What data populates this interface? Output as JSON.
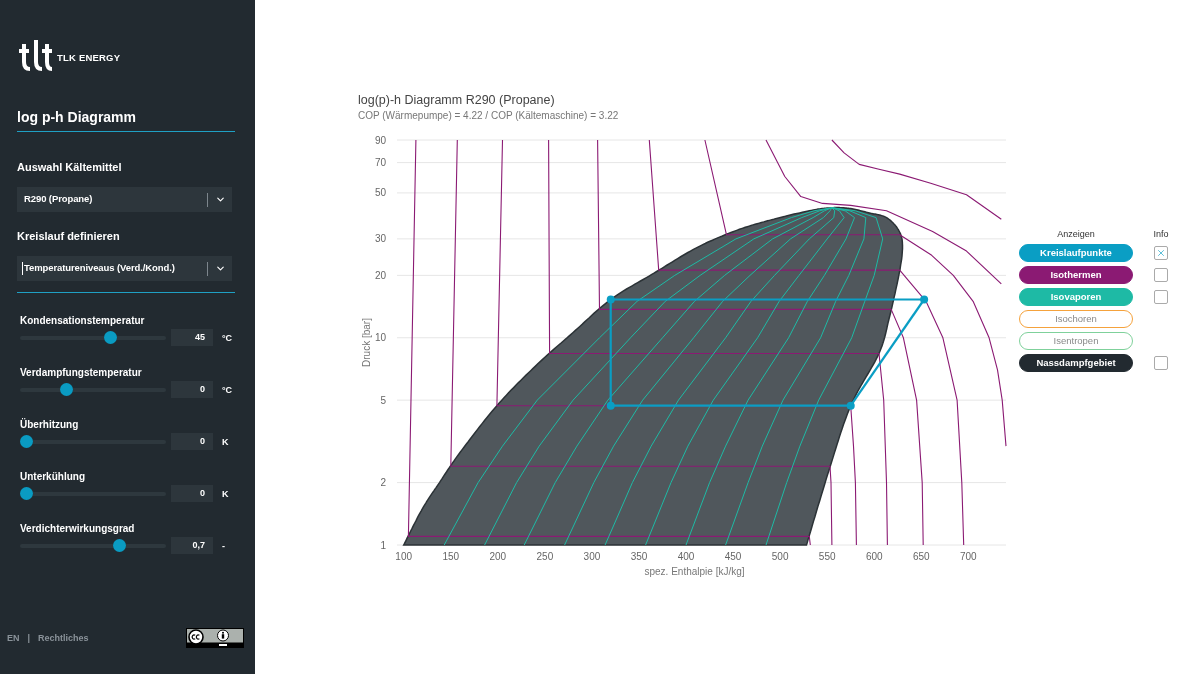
{
  "sidebar": {
    "brand": "TLK ENERGY",
    "heading": "log p-h Diagramm",
    "selects": [
      {
        "label": "Auswahl Kältemittel",
        "value": "R290 (Propane)",
        "focused": false
      },
      {
        "label": "Kreislauf definieren",
        "value": "Temperatureniveaus (Verd./Kond.)",
        "focused": true
      }
    ],
    "sliders": [
      {
        "label": "Kondensationstemperatur",
        "level": 0.63,
        "value": "45",
        "unit": "°C"
      },
      {
        "label": "Verdampfungstemperatur",
        "level": 0.3,
        "value": "0",
        "unit": "°C"
      },
      {
        "label": "Überhitzung",
        "level": 0,
        "value": "0",
        "unit": "K"
      },
      {
        "label": "Unterkühlung",
        "level": 0,
        "value": "0",
        "unit": "K"
      },
      {
        "label": "Verdichterwirkungsgrad",
        "level": 0.7,
        "value": "0,7",
        "unit": "-"
      }
    ],
    "footer": {
      "language": "EN",
      "separator": "|",
      "legal": "Rechtliches"
    }
  },
  "chart": {
    "subtitle": "COP (Wärmepumpe) = 4.22 / COP (Kältemaschine) = 3.22",
    "chart_data": {
      "type": "line",
      "title": "log(p)-h Diagramm R290 (Propane)",
      "xlabel": "spez. Enthalpie [kJ/kg]",
      "ylabel": "Druck [bar]",
      "xlim": [
        95,
        740
      ],
      "ylim": [
        1,
        90
      ],
      "log": true,
      "grid": true,
      "xticks": [
        100,
        150,
        200,
        250,
        300,
        350,
        400,
        450,
        500,
        550,
        600,
        650,
        700
      ],
      "yticks": [
        1,
        2,
        5,
        10,
        20,
        30,
        50,
        70,
        90
      ],
      "series": [
        {
          "type": "area",
          "color": "#50575c",
          "x": [
            100,
            120,
            138,
            160,
            199,
            240,
            280,
            320,
            366,
            410,
            450,
            485,
            531,
            555,
            575,
            595,
            613,
            626,
            630,
            627,
            616,
            605,
            575,
            552,
            528
          ],
          "values": [
            1,
            1.5,
            2,
            2.8,
            4.7,
            7.3,
            10.6,
            15.3,
            20.5,
            27,
            32.5,
            36.5,
            41,
            42.4,
            42,
            40,
            38,
            33,
            28,
            21,
            12.5,
            8.4,
            4.7,
            2.3,
            1
          ]
        },
        {
          "type": "line",
          "color": "#8b1a73",
          "x": [
            113,
            105,
            531,
            532
          ],
          "values": [
            90,
            1.1,
            1.1,
            1
          ]
        },
        {
          "type": "line",
          "color": "#8b1a73",
          "x": [
            157,
            150,
            553,
            554,
            555
          ],
          "values": [
            90,
            2.4,
            2.4,
            2,
            1
          ]
        },
        {
          "type": "line",
          "color": "#8b1a73",
          "x": [
            205,
            199,
            575,
            578,
            580,
            581
          ],
          "values": [
            90,
            4.7,
            4.7,
            3,
            2,
            1
          ]
        },
        {
          "type": "line",
          "color": "#8b1a73",
          "x": [
            254,
            255,
            605,
            610,
            613,
            614
          ],
          "values": [
            90,
            8.4,
            8.4,
            5,
            2,
            1
          ]
        },
        {
          "type": "line",
          "color": "#8b1a73",
          "x": [
            306,
            308,
            618,
            631,
            645,
            651,
            652
          ],
          "values": [
            90,
            13.7,
            13.7,
            10,
            5,
            2,
            1
          ]
        },
        {
          "type": "line",
          "color": "#8b1a73",
          "x": [
            361,
            371,
            627,
            655,
            673,
            688,
            693,
            695
          ],
          "values": [
            90,
            21.2,
            21.2,
            15,
            10,
            5,
            2,
            1
          ]
        },
        {
          "type": "line",
          "color": "#8b1a73",
          "x": [
            420,
            443,
            627,
            661,
            684,
            705,
            722,
            731,
            736,
            740
          ],
          "values": [
            90,
            31.4,
            31.4,
            25,
            20,
            15,
            10,
            7,
            5,
            3
          ]
        },
        {
          "type": "line",
          "color": "#8b1a73",
          "x": [
            485,
            494,
            505,
            522,
            545,
            575,
            613,
            662,
            698,
            735
          ],
          "values": [
            90,
            75,
            60,
            48,
            44.5,
            43.5,
            41,
            32.6,
            26.2,
            18.2
          ]
        },
        {
          "type": "line",
          "color": "#8b1a73",
          "x": [
            555,
            568,
            584,
            605,
            627,
            660,
            698,
            735
          ],
          "values": [
            90,
            78,
            68.6,
            65,
            61.6,
            55.7,
            49,
            37.3
          ]
        },
        {
          "type": "line",
          "color": "#1ebaa5",
          "x": [
            143,
            179,
            205,
            242,
            308,
            348,
            388,
            453,
            512,
            536,
            555
          ],
          "values": [
            1,
            2,
            3,
            5,
            10,
            15,
            20,
            30,
            38,
            41,
            42.4
          ]
        },
        {
          "type": "line",
          "color": "#1ebaa5",
          "x": [
            186,
            220,
            244,
            280,
            341,
            378,
            415,
            472,
            523,
            542,
            555
          ],
          "values": [
            1,
            2,
            3,
            5,
            10,
            15,
            20,
            30,
            38,
            41,
            42.4
          ]
        },
        {
          "type": "line",
          "color": "#1ebaa5",
          "x": [
            228,
            261,
            284,
            317,
            375,
            409,
            441,
            492,
            535,
            547,
            555
          ],
          "values": [
            1,
            2,
            3,
            5,
            10,
            15,
            20,
            30,
            38,
            41,
            42.4
          ]
        },
        {
          "type": "line",
          "color": "#1ebaa5",
          "x": [
            271,
            302,
            323,
            354,
            408,
            439,
            468,
            511,
            546,
            553,
            555
          ],
          "values": [
            1,
            2,
            3,
            5,
            10,
            15,
            20,
            30,
            38,
            41,
            42.4
          ]
        },
        {
          "type": "line",
          "color": "#1ebaa5",
          "x": [
            314,
            343,
            363,
            392,
            442,
            469,
            494,
            531,
            557,
            558,
            555
          ],
          "values": [
            1,
            2,
            3,
            5,
            10,
            15,
            20,
            30,
            38,
            41,
            42.4
          ]
        },
        {
          "type": "line",
          "color": "#1ebaa5",
          "x": [
            357,
            384,
            402,
            429,
            476,
            499,
            520,
            550,
            568,
            563,
            555
          ],
          "values": [
            1,
            2,
            3,
            5,
            10,
            15,
            20,
            30,
            38,
            41,
            42.4
          ]
        },
        {
          "type": "line",
          "color": "#1ebaa5",
          "x": [
            400,
            425,
            442,
            466,
            509,
            529,
            547,
            570,
            579,
            569,
            555
          ],
          "values": [
            1,
            2,
            3,
            5,
            10,
            15,
            20,
            30,
            38,
            41,
            42.4
          ]
        },
        {
          "type": "line",
          "color": "#1ebaa5",
          "x": [
            442,
            466,
            481,
            503,
            543,
            559,
            573,
            589,
            591,
            574,
            555
          ],
          "values": [
            1,
            2,
            3,
            5,
            10,
            15,
            20,
            30,
            38,
            41,
            42.4
          ]
        },
        {
          "type": "line",
          "color": "#1ebaa5",
          "x": [
            485,
            507,
            521,
            541,
            576,
            590,
            600,
            609,
            602,
            580,
            555
          ],
          "values": [
            1,
            2,
            3,
            5,
            10,
            15,
            20,
            30,
            38,
            41,
            42.4
          ]
        },
        {
          "type": "line",
          "color": "#0a9ec4",
          "marker": true,
          "x": [
            320,
            320,
            653
          ],
          "values": [
            4.7,
            15.3,
            15.3
          ]
        },
        {
          "type": "line",
          "color": "#0a9ec4",
          "marker": true,
          "x": [
            320,
            575
          ],
          "values": [
            4.7,
            4.7
          ]
        },
        {
          "type": "line",
          "color": "#0a9ec4",
          "marker": true,
          "x": [
            575,
            653
          ],
          "values": [
            4.7,
            15.3
          ]
        }
      ]
    }
  },
  "legend": {
    "headers": [
      "Anzeigen",
      "Info"
    ],
    "items": [
      {
        "label": "Kreislaufpunkte",
        "color": "#0a9ec4",
        "active": true,
        "info": true
      },
      {
        "label": "Isothermen",
        "color": "#8b1a73",
        "active": true,
        "info": false
      },
      {
        "label": "Isovaporen",
        "color": "#1ebaa5",
        "active": true,
        "info": false
      },
      {
        "label": "Isochoren",
        "color": "#f5a23c",
        "active": false
      },
      {
        "label": "Isentropen",
        "color": "#7fd19b",
        "active": false
      },
      {
        "label": "Nassdampfgebiet",
        "color": "#222a30",
        "active": true,
        "info": false
      }
    ]
  }
}
